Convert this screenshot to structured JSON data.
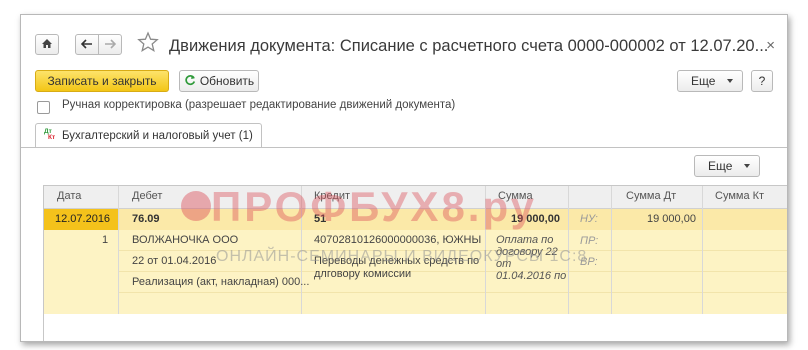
{
  "window": {
    "title": "Движения документа: Списание с расчетного счета 0000-000002 от 12.07.20...",
    "close_symbol": "×"
  },
  "nav": {
    "home_icon": "home-icon",
    "back_symbol": "🡐",
    "forward_symbol": "🡒",
    "star_symbol": "☆"
  },
  "toolbar": {
    "save_close_label": "Записать и закрыть",
    "refresh_label": "Обновить",
    "more_label": "Еще",
    "help_label": "?"
  },
  "manual_correction": {
    "label": "Ручная корректировка (разрешает редактирование движений документа)",
    "checked": false
  },
  "tabs": [
    {
      "label": "Бухгалтерский и налоговый учет (1)",
      "icon": "dt-kt-icon",
      "icon_text_top": "Дт",
      "icon_text_bottom": "Кт"
    }
  ],
  "table_toolbar": {
    "more_label": "Еще"
  },
  "table": {
    "columns": [
      "Дата",
      "Дебет",
      "Кредит",
      "Сумма",
      "Сумма Дт",
      "Сумма Кт"
    ],
    "row": {
      "date": "12.07.2016",
      "number": "1",
      "debit_account": "76.09",
      "debit_sub1": "ВОЛЖАНОЧКА ООО",
      "debit_sub2": "22 от 01.04.2016",
      "debit_sub3": "Реализация (акт, накладная) 000...",
      "credit_account": "51",
      "credit_sub1": "40702810126000000036, ЮЖНЫ",
      "credit_sub2": "Переводы денежных средств по",
      "credit_sub3": "длговору комиссии",
      "amount": "19 000,00",
      "amount_desc": [
        "Оплата по",
        "договору 22",
        "от",
        "01.04.2016 по"
      ],
      "nu_label": "НУ:",
      "pr_label": "ПР:",
      "vr_label": "ВР:",
      "amount_dt": "19 000,00"
    }
  },
  "watermark": {
    "brand": "ПРОФБУХ8.ру",
    "tagline": "ОНЛАЙН-СЕМИНАРЫ И ВИДЕОКУРСЫ 1С:8"
  }
}
